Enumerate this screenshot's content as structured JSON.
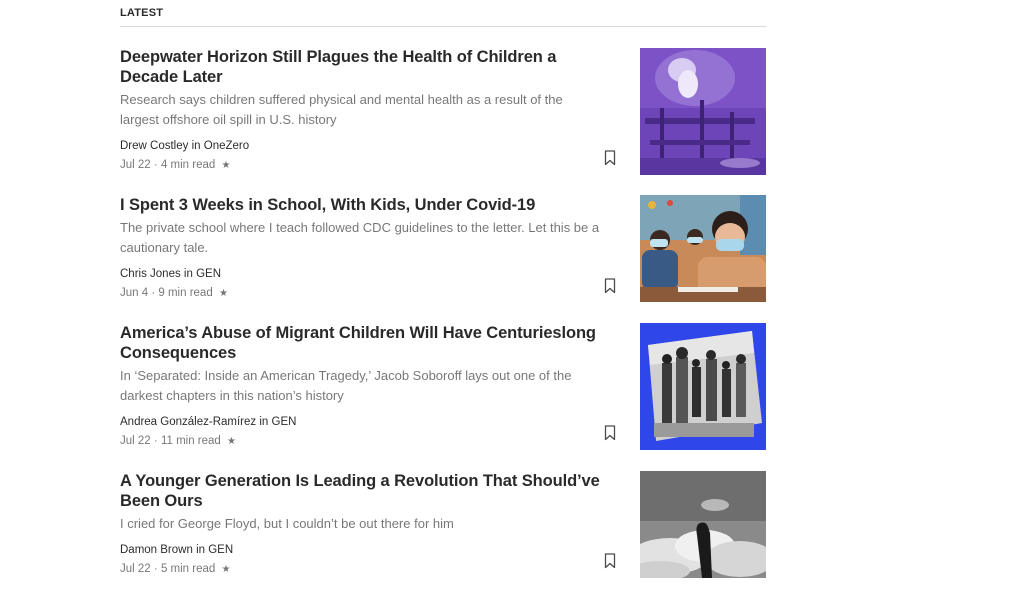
{
  "section": {
    "title": "LATEST"
  },
  "articles": [
    {
      "title": "Deepwater Horizon Still Plagues the Health of Children a Decade Later",
      "subtitle": "Research says children suffered physical and mental health as a result of the largest offshore oil spill in U.S. history",
      "author": "Drew Costley",
      "in_word": "in",
      "publication": "OneZero",
      "date": "Jul 22",
      "read_time": "4 min read",
      "star": "★",
      "separator": "·",
      "image": "oil-rig-fire-purple-photo"
    },
    {
      "title": "I Spent 3 Weeks in School, With Kids, Under Covid-19",
      "subtitle": "The private school where I teach followed CDC guidelines to the letter. Let this be a cautionary tale.",
      "author": "Chris Jones",
      "in_word": "in",
      "publication": "GEN",
      "date": "Jun 4",
      "read_time": "9 min read",
      "star": "★",
      "separator": "·",
      "image": "masked-schoolchildren-photo"
    },
    {
      "title": "America’s Abuse of Migrant Children Will Have Centurieslong Consequences",
      "subtitle": "In ‘Separated: Inside an American Tragedy,’ Jacob Soboroff lays out one of the darkest chapters in this nation’s history",
      "author": "Andrea González-Ramírez",
      "in_word": "in",
      "publication": "GEN",
      "date": "Jul 22",
      "read_time": "11 min read",
      "star": "★",
      "separator": "·",
      "image": "migrant-families-blue-photo"
    },
    {
      "title": "A Younger Generation Is Leading a Revolution That Should’ve Been Ours",
      "subtitle": "I cried for George Floyd, but I couldn’t be out there for him",
      "author": "Damon Brown",
      "in_word": "in",
      "publication": "GEN",
      "date": "Jul 22",
      "read_time": "5 min read",
      "star": "★",
      "separator": "·",
      "image": "raised-fist-sky-photo"
    }
  ]
}
